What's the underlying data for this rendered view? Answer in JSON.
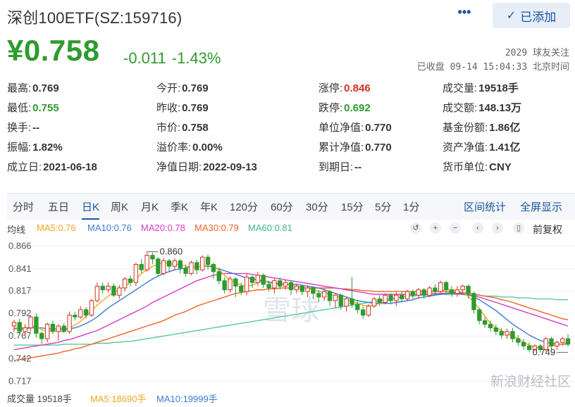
{
  "header": {
    "title": "深创100ETF(SZ:159716)",
    "more_label": "•••",
    "added_label": "已添加",
    "price": "¥0.758",
    "change": "-0.011",
    "change_pct": "-1.43%",
    "followers": "2029 球友关注",
    "status": "已收盘 09-14 15:04:33 北京时间"
  },
  "stats": [
    [
      {
        "label": "最高:",
        "value": "0.769"
      },
      {
        "label": "今开:",
        "value": "0.769"
      },
      {
        "label": "涨停:",
        "value": "0.846",
        "tone": "red"
      },
      {
        "label": "成交量:",
        "value": "19518手"
      }
    ],
    [
      {
        "label": "最低:",
        "value": "0.755",
        "tone": "green"
      },
      {
        "label": "昨收:",
        "value": "0.769"
      },
      {
        "label": "跌停:",
        "value": "0.692",
        "tone": "green"
      },
      {
        "label": "成交额:",
        "value": "148.13万"
      }
    ],
    [
      {
        "label": "换手:",
        "value": "--"
      },
      {
        "label": "市价:",
        "value": "0.758"
      },
      {
        "label": "单位净值:",
        "value": "0.770"
      },
      {
        "label": "基金份额:",
        "value": "1.86亿"
      }
    ],
    [
      {
        "label": "振幅:",
        "value": "1.82%"
      },
      {
        "label": "溢价率:",
        "value": "0.00%"
      },
      {
        "label": "累计净值:",
        "value": "0.770"
      },
      {
        "label": "资产净值:",
        "value": "1.41亿"
      }
    ],
    [
      {
        "label": "成立日:",
        "value": "2021-06-18"
      },
      {
        "label": "净值日期:",
        "value": "2022-09-13"
      },
      {
        "label": "到期日:",
        "value": "--"
      },
      {
        "label": "货币单位:",
        "value": "CNY"
      }
    ]
  ],
  "tabs": [
    "分时",
    "五日",
    "日K",
    "周K",
    "月K",
    "季K",
    "年K",
    "120分",
    "60分",
    "30分",
    "15分",
    "5分",
    "1分"
  ],
  "active_tab": "日K",
  "tabs_right": [
    "区间统计",
    "全屏显示"
  ],
  "ma": {
    "label": "均线",
    "ma5": "MA5:0.76",
    "ma10": "MA10:0.76",
    "ma20": "MA20:0.78",
    "ma30": "MA30:0.79",
    "ma60": "MA60:0.81",
    "fq": "前复权"
  },
  "colors": {
    "up": "#d3311f",
    "down": "#2e9b2e",
    "ma5": "#f5a623",
    "ma10": "#3a7bd5",
    "ma20": "#d63cc4",
    "ma30": "#f0642a",
    "ma60": "#5cc89a",
    "accent": "#1a55a3"
  },
  "volume": {
    "label": "成交量 19518手",
    "ma5": "MA5:18690手",
    "ma10": "MA10:19999手"
  },
  "watermark": "雪球",
  "sina_brand": "新浪财经社区",
  "chart_data": {
    "type": "candlestick",
    "y_ticks": [
      "0.866",
      "0.841",
      "0.817",
      "0.792",
      "0.767",
      "0.742",
      "0.717"
    ],
    "ylim": [
      0.712,
      0.872
    ],
    "annotations": [
      {
        "label": "0.860",
        "value": 0.86,
        "index": 24
      },
      {
        "label": "0.749",
        "value": 0.749,
        "index": 100
      }
    ],
    "candles": [
      [
        0.778,
        0.782,
        0.771,
        0.785
      ],
      [
        0.782,
        0.772,
        0.768,
        0.786
      ],
      [
        0.772,
        0.776,
        0.768,
        0.78
      ],
      [
        0.776,
        0.788,
        0.772,
        0.79
      ],
      [
        0.788,
        0.77,
        0.765,
        0.792
      ],
      [
        0.77,
        0.764,
        0.758,
        0.772
      ],
      [
        0.764,
        0.78,
        0.76,
        0.782
      ],
      [
        0.78,
        0.772,
        0.769,
        0.784
      ],
      [
        0.772,
        0.778,
        0.762,
        0.78
      ],
      [
        0.778,
        0.772,
        0.77,
        0.781
      ],
      [
        0.772,
        0.79,
        0.769,
        0.794
      ],
      [
        0.79,
        0.788,
        0.784,
        0.794
      ],
      [
        0.788,
        0.796,
        0.786,
        0.8
      ],
      [
        0.796,
        0.79,
        0.786,
        0.799
      ],
      [
        0.79,
        0.806,
        0.788,
        0.808
      ],
      [
        0.806,
        0.822,
        0.804,
        0.826
      ],
      [
        0.822,
        0.818,
        0.814,
        0.826
      ],
      [
        0.818,
        0.822,
        0.815,
        0.826
      ],
      [
        0.822,
        0.812,
        0.81,
        0.825
      ],
      [
        0.812,
        0.82,
        0.808,
        0.823
      ],
      [
        0.82,
        0.83,
        0.816,
        0.832
      ],
      [
        0.83,
        0.826,
        0.822,
        0.834
      ],
      [
        0.826,
        0.846,
        0.822,
        0.848
      ],
      [
        0.846,
        0.84,
        0.836,
        0.852
      ],
      [
        0.84,
        0.856,
        0.838,
        0.86
      ],
      [
        0.856,
        0.852,
        0.846,
        0.859
      ],
      [
        0.852,
        0.836,
        0.833,
        0.854
      ],
      [
        0.836,
        0.85,
        0.834,
        0.853
      ],
      [
        0.85,
        0.844,
        0.838,
        0.852
      ],
      [
        0.844,
        0.85,
        0.84,
        0.853
      ],
      [
        0.85,
        0.842,
        0.836,
        0.852
      ],
      [
        0.842,
        0.836,
        0.832,
        0.846
      ],
      [
        0.836,
        0.848,
        0.834,
        0.85
      ],
      [
        0.848,
        0.84,
        0.835,
        0.851
      ],
      [
        0.84,
        0.854,
        0.838,
        0.856
      ],
      [
        0.854,
        0.846,
        0.84,
        0.857
      ],
      [
        0.846,
        0.838,
        0.83,
        0.848
      ],
      [
        0.838,
        0.828,
        0.824,
        0.842
      ],
      [
        0.828,
        0.818,
        0.814,
        0.832
      ],
      [
        0.818,
        0.83,
        0.815,
        0.833
      ],
      [
        0.83,
        0.822,
        0.81,
        0.832
      ],
      [
        0.822,
        0.816,
        0.812,
        0.826
      ],
      [
        0.816,
        0.832,
        0.812,
        0.836
      ],
      [
        0.832,
        0.826,
        0.82,
        0.834
      ],
      [
        0.826,
        0.834,
        0.822,
        0.838
      ],
      [
        0.834,
        0.824,
        0.82,
        0.836
      ],
      [
        0.824,
        0.82,
        0.816,
        0.828
      ],
      [
        0.82,
        0.828,
        0.814,
        0.83
      ],
      [
        0.828,
        0.822,
        0.818,
        0.832
      ],
      [
        0.822,
        0.826,
        0.818,
        0.829
      ],
      [
        0.826,
        0.818,
        0.812,
        0.828
      ],
      [
        0.818,
        0.822,
        0.814,
        0.825
      ],
      [
        0.822,
        0.816,
        0.812,
        0.824
      ],
      [
        0.816,
        0.82,
        0.81,
        0.823
      ],
      [
        0.82,
        0.814,
        0.808,
        0.822
      ],
      [
        0.814,
        0.81,
        0.804,
        0.818
      ],
      [
        0.81,
        0.816,
        0.806,
        0.819
      ],
      [
        0.816,
        0.806,
        0.8,
        0.818
      ],
      [
        0.806,
        0.812,
        0.798,
        0.814
      ],
      [
        0.812,
        0.8,
        0.796,
        0.814
      ],
      [
        0.8,
        0.808,
        0.794,
        0.81
      ],
      [
        0.808,
        0.802,
        0.798,
        0.832
      ],
      [
        0.802,
        0.796,
        0.792,
        0.806
      ],
      [
        0.796,
        0.79,
        0.786,
        0.8
      ],
      [
        0.79,
        0.8,
        0.788,
        0.802
      ],
      [
        0.8,
        0.808,
        0.798,
        0.81
      ],
      [
        0.808,
        0.804,
        0.8,
        0.812
      ],
      [
        0.804,
        0.812,
        0.802,
        0.814
      ],
      [
        0.812,
        0.806,
        0.802,
        0.814
      ],
      [
        0.806,
        0.812,
        0.8,
        0.815
      ],
      [
        0.812,
        0.808,
        0.804,
        0.816
      ],
      [
        0.808,
        0.816,
        0.806,
        0.818
      ],
      [
        0.816,
        0.812,
        0.808,
        0.818
      ],
      [
        0.812,
        0.818,
        0.808,
        0.82
      ],
      [
        0.818,
        0.812,
        0.808,
        0.82
      ],
      [
        0.812,
        0.82,
        0.81,
        0.822
      ],
      [
        0.82,
        0.816,
        0.812,
        0.824
      ],
      [
        0.816,
        0.826,
        0.814,
        0.828
      ],
      [
        0.826,
        0.818,
        0.812,
        0.828
      ],
      [
        0.818,
        0.814,
        0.81,
        0.822
      ],
      [
        0.814,
        0.818,
        0.81,
        0.822
      ],
      [
        0.818,
        0.822,
        0.814,
        0.824
      ],
      [
        0.822,
        0.814,
        0.808,
        0.824
      ],
      [
        0.814,
        0.796,
        0.792,
        0.816
      ],
      [
        0.796,
        0.784,
        0.78,
        0.798
      ],
      [
        0.784,
        0.78,
        0.776,
        0.788
      ],
      [
        0.78,
        0.776,
        0.772,
        0.784
      ],
      [
        0.776,
        0.772,
        0.768,
        0.78
      ],
      [
        0.772,
        0.768,
        0.764,
        0.776
      ],
      [
        0.768,
        0.772,
        0.764,
        0.775
      ],
      [
        0.772,
        0.764,
        0.76,
        0.776
      ],
      [
        0.764,
        0.76,
        0.756,
        0.768
      ],
      [
        0.76,
        0.756,
        0.752,
        0.764
      ],
      [
        0.756,
        0.752,
        0.749,
        0.76
      ],
      [
        0.752,
        0.756,
        0.75,
        0.758
      ],
      [
        0.756,
        0.752,
        0.749,
        0.758
      ],
      [
        0.752,
        0.764,
        0.75,
        0.766
      ],
      [
        0.764,
        0.756,
        0.752,
        0.766
      ],
      [
        0.756,
        0.76,
        0.752,
        0.762
      ],
      [
        0.76,
        0.764,
        0.756,
        0.766
      ],
      [
        0.764,
        0.758,
        0.755,
        0.769
      ]
    ],
    "ma_series": {
      "ma5": [
        0.776,
        0.776,
        0.776,
        0.777,
        0.778,
        0.774,
        0.772,
        0.773,
        0.772,
        0.772,
        0.776,
        0.779,
        0.783,
        0.789,
        0.795,
        0.801,
        0.806,
        0.811,
        0.815,
        0.818,
        0.822,
        0.826,
        0.83,
        0.836,
        0.84,
        0.844,
        0.846,
        0.848,
        0.847,
        0.846,
        0.846,
        0.844,
        0.843,
        0.843,
        0.844,
        0.845,
        0.844,
        0.84,
        0.834,
        0.829,
        0.826,
        0.823,
        0.822,
        0.823,
        0.826,
        0.828,
        0.827,
        0.826,
        0.825,
        0.824,
        0.823,
        0.822,
        0.821,
        0.82,
        0.818,
        0.816,
        0.815,
        0.813,
        0.811,
        0.809,
        0.807,
        0.805,
        0.803,
        0.801,
        0.8,
        0.801,
        0.803,
        0.805,
        0.807,
        0.809,
        0.81,
        0.811,
        0.812,
        0.813,
        0.814,
        0.815,
        0.816,
        0.817,
        0.818,
        0.818,
        0.817,
        0.815,
        0.811,
        0.804,
        0.797,
        0.789,
        0.781,
        0.776,
        0.773,
        0.77,
        0.767,
        0.764,
        0.76,
        0.757,
        0.755,
        0.754,
        0.755,
        0.756,
        0.757,
        0.758,
        0.76
      ],
      "ma10": [
        0.775,
        0.775,
        0.775,
        0.776,
        0.776,
        0.776,
        0.775,
        0.775,
        0.775,
        0.775,
        0.775,
        0.776,
        0.778,
        0.781,
        0.784,
        0.788,
        0.793,
        0.798,
        0.802,
        0.806,
        0.81,
        0.814,
        0.818,
        0.822,
        0.826,
        0.83,
        0.833,
        0.836,
        0.838,
        0.84,
        0.841,
        0.842,
        0.843,
        0.843,
        0.844,
        0.844,
        0.843,
        0.841,
        0.839,
        0.837,
        0.835,
        0.833,
        0.831,
        0.83,
        0.829,
        0.828,
        0.826,
        0.825,
        0.824,
        0.824,
        0.824,
        0.824,
        0.823,
        0.822,
        0.821,
        0.82,
        0.818,
        0.816,
        0.814,
        0.812,
        0.81,
        0.808,
        0.806,
        0.805,
        0.804,
        0.803,
        0.803,
        0.803,
        0.803,
        0.804,
        0.805,
        0.806,
        0.807,
        0.809,
        0.81,
        0.811,
        0.812,
        0.813,
        0.814,
        0.815,
        0.815,
        0.814,
        0.813,
        0.81,
        0.807,
        0.803,
        0.799,
        0.795,
        0.79,
        0.785,
        0.78,
        0.776,
        0.772,
        0.768,
        0.765,
        0.762,
        0.76,
        0.759,
        0.758,
        0.758,
        0.758
      ],
      "ma20": [
        0.752,
        0.753,
        0.754,
        0.755,
        0.756,
        0.757,
        0.758,
        0.759,
        0.76,
        0.762,
        0.763,
        0.765,
        0.767,
        0.769,
        0.771,
        0.773,
        0.776,
        0.779,
        0.782,
        0.785,
        0.788,
        0.791,
        0.794,
        0.797,
        0.8,
        0.804,
        0.807,
        0.81,
        0.813,
        0.816,
        0.819,
        0.822,
        0.825,
        0.828,
        0.83,
        0.832,
        0.834,
        0.835,
        0.836,
        0.836,
        0.836,
        0.836,
        0.836,
        0.835,
        0.834,
        0.833,
        0.832,
        0.831,
        0.83,
        0.829,
        0.828,
        0.827,
        0.826,
        0.825,
        0.824,
        0.823,
        0.822,
        0.821,
        0.82,
        0.819,
        0.818,
        0.817,
        0.816,
        0.815,
        0.814,
        0.813,
        0.813,
        0.813,
        0.813,
        0.813,
        0.813,
        0.813,
        0.813,
        0.813,
        0.813,
        0.813,
        0.814,
        0.814,
        0.814,
        0.814,
        0.814,
        0.813,
        0.812,
        0.811,
        0.81,
        0.808,
        0.806,
        0.804,
        0.802,
        0.8,
        0.798,
        0.796,
        0.794,
        0.792,
        0.79,
        0.788,
        0.786,
        0.784,
        0.782,
        0.78,
        0.778
      ],
      "ma30": [
        0.74,
        0.741,
        0.742,
        0.743,
        0.744,
        0.745,
        0.746,
        0.747,
        0.748,
        0.75,
        0.751,
        0.753,
        0.754,
        0.756,
        0.758,
        0.76,
        0.762,
        0.764,
        0.766,
        0.768,
        0.77,
        0.772,
        0.774,
        0.776,
        0.778,
        0.78,
        0.782,
        0.784,
        0.787,
        0.79,
        0.792,
        0.794,
        0.797,
        0.8,
        0.802,
        0.804,
        0.806,
        0.808,
        0.81,
        0.812,
        0.814,
        0.815,
        0.816,
        0.817,
        0.818,
        0.818,
        0.819,
        0.819,
        0.82,
        0.82,
        0.82,
        0.82,
        0.82,
        0.82,
        0.82,
        0.82,
        0.82,
        0.82,
        0.82,
        0.819,
        0.819,
        0.818,
        0.818,
        0.817,
        0.817,
        0.816,
        0.816,
        0.816,
        0.816,
        0.816,
        0.816,
        0.816,
        0.816,
        0.816,
        0.816,
        0.816,
        0.816,
        0.816,
        0.816,
        0.816,
        0.815,
        0.815,
        0.814,
        0.813,
        0.812,
        0.811,
        0.81,
        0.809,
        0.807,
        0.806,
        0.804,
        0.802,
        0.8,
        0.798,
        0.796,
        0.794,
        0.792,
        0.79,
        0.788,
        0.786,
        0.785
      ],
      "ma60": [
        0.757,
        0.757,
        0.757,
        0.757,
        0.757,
        0.757,
        0.757,
        0.757,
        0.757,
        0.758,
        0.758,
        0.758,
        0.758,
        0.758,
        0.758,
        0.759,
        0.759,
        0.759,
        0.76,
        0.76,
        0.761,
        0.761,
        0.762,
        0.763,
        0.764,
        0.765,
        0.766,
        0.767,
        0.768,
        0.769,
        0.77,
        0.771,
        0.772,
        0.773,
        0.774,
        0.775,
        0.776,
        0.777,
        0.778,
        0.779,
        0.78,
        0.781,
        0.782,
        0.783,
        0.784,
        0.785,
        0.786,
        0.787,
        0.788,
        0.789,
        0.79,
        0.791,
        0.792,
        0.793,
        0.794,
        0.795,
        0.796,
        0.797,
        0.798,
        0.799,
        0.8,
        0.801,
        0.802,
        0.803,
        0.804,
        0.805,
        0.806,
        0.807,
        0.808,
        0.809,
        0.81,
        0.811,
        0.811,
        0.812,
        0.812,
        0.813,
        0.813,
        0.813,
        0.813,
        0.813,
        0.813,
        0.813,
        0.812,
        0.812,
        0.812,
        0.811,
        0.811,
        0.811,
        0.81,
        0.81,
        0.81,
        0.809,
        0.809,
        0.809,
        0.808,
        0.808,
        0.808,
        0.808,
        0.807,
        0.807,
        0.807
      ]
    }
  }
}
